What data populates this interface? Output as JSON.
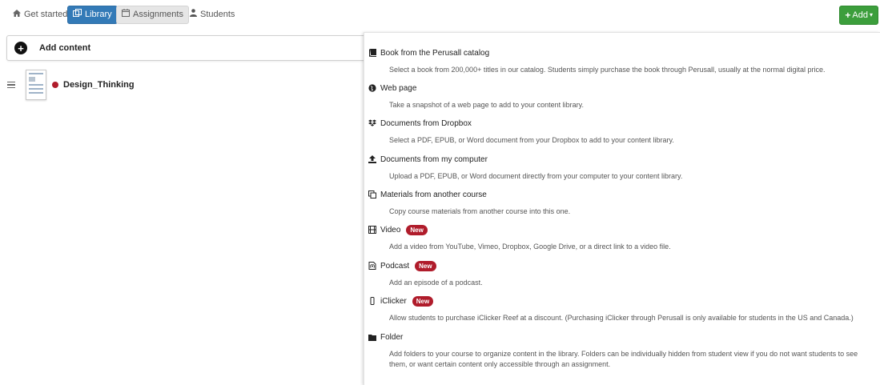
{
  "topnav": {
    "tabs": [
      {
        "label": "Get started",
        "icon": "home-icon"
      },
      {
        "label": "Library",
        "icon": "library-icon",
        "active": true
      },
      {
        "label": "Assignments",
        "icon": "calendar-icon"
      },
      {
        "label": "Students",
        "icon": "user-icon"
      }
    ],
    "add_button": {
      "label": "Add",
      "icon": "plus-icon"
    }
  },
  "left": {
    "add_content_label": "Add content",
    "documents": [
      {
        "name": "Design_Thinking"
      }
    ]
  },
  "add_menu": {
    "options": [
      {
        "title": "Book from the Perusall catalog",
        "icon": "book-icon",
        "description": "Select a book from 200,000+ titles in our catalog. Students simply purchase the book through Perusall, usually at the normal digital price."
      },
      {
        "title": "Web page",
        "icon": "globe-icon",
        "description": "Take a snapshot of a web page to add to your content library."
      },
      {
        "title": "Documents from Dropbox",
        "icon": "dropbox-icon",
        "description": "Select a PDF, EPUB, or Word document from your Dropbox to add to your content library."
      },
      {
        "title": "Documents from my computer",
        "icon": "upload-icon",
        "description": "Upload a PDF, EPUB, or Word document directly from your computer to your content library."
      },
      {
        "title": "Materials from another course",
        "icon": "copy-icon",
        "description": "Copy course materials from another course into this one."
      },
      {
        "title": "Video",
        "icon": "film-icon",
        "badge": "New",
        "description": "Add a video from YouTube, Vimeo, Dropbox, Google Drive, or a direct link to a video file."
      },
      {
        "title": "Podcast",
        "icon": "podcast-icon",
        "badge": "New",
        "description": "Add an episode of a podcast."
      },
      {
        "title": "iClicker",
        "icon": "clicker-icon",
        "badge": "New",
        "description": "Allow students to purchase iClicker Reef at a discount. (Purchasing iClicker through Perusall is only available for students in the US and Canada.)"
      },
      {
        "title": "Folder",
        "icon": "folder-icon",
        "description": "Add folders to your course to organize content in the library. Folders can be individually hidden from student view if you do not want students to see them, or want certain content only accessible through an assignment."
      }
    ]
  },
  "colors": {
    "primary": "#337ab7",
    "success": "#3c9e3c",
    "badge": "#b01c2b"
  }
}
